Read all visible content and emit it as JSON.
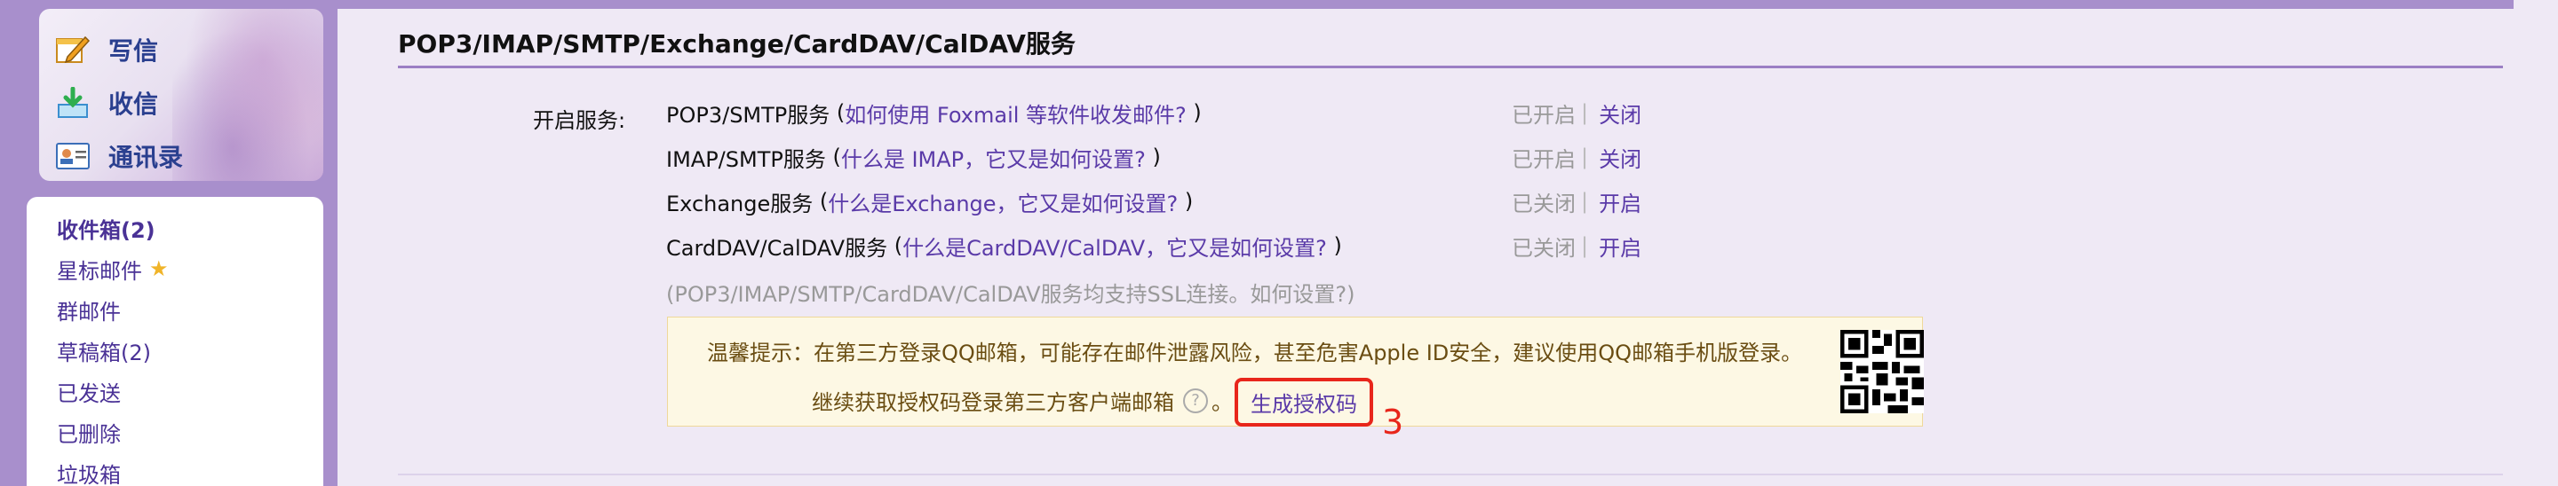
{
  "sidebar": {
    "actions": [
      {
        "label": "写信",
        "icon": "compose-icon"
      },
      {
        "label": "收信",
        "icon": "download-inbox-icon"
      },
      {
        "label": "通讯录",
        "icon": "contacts-card-icon"
      }
    ],
    "folders": [
      {
        "label": "收件箱(2)",
        "bold": true
      },
      {
        "label": "星标邮件",
        "star": "★"
      },
      {
        "label": "群邮件"
      },
      {
        "label": "草稿箱(2)"
      },
      {
        "label": "已发送"
      },
      {
        "label": "已删除"
      },
      {
        "label": "垃圾箱"
      }
    ]
  },
  "section": {
    "title": "POP3/IMAP/SMTP/Exchange/CardDAV/CalDAV服务",
    "open_label": "开启服务:",
    "services": [
      {
        "name": "POP3/SMTP服务",
        "help": "如何使用 Foxmail 等软件收发邮件?",
        "status": "已开启",
        "toggle": "关闭"
      },
      {
        "name": "IMAP/SMTP服务",
        "help": "什么是 IMAP，它又是如何设置?",
        "status": "已开启",
        "toggle": "关闭"
      },
      {
        "name": "Exchange服务",
        "help": "什么是Exchange，它又是如何设置?",
        "status": "已关闭",
        "toggle": "开启"
      },
      {
        "name": "CardDAV/CalDAV服务",
        "help": "什么是CardDAV/CalDAV，它又是如何设置?",
        "status": "已关闭",
        "toggle": "开启"
      }
    ],
    "ssl_note_prefix": "(POP3/IMAP/SMTP/CardDAV/CalDAV服务均支持SSL连接。",
    "ssl_note_link": "如何设置?",
    "ssl_note_suffix": ")",
    "tip_line1": "温馨提示：在第三方登录QQ邮箱，可能存在邮件泄露风险，甚至危害Apple ID安全，建议使用QQ邮箱手机版登录。",
    "tip_line2": "继续获取授权码登录第三方客户端邮箱",
    "tip_line2_end": "。",
    "generate_code_button": "生成授权码",
    "annotation_number": "3"
  },
  "colors": {
    "accent": "#5a3aa8",
    "frame": "#a88fcc",
    "highlight": "#e8261b"
  }
}
